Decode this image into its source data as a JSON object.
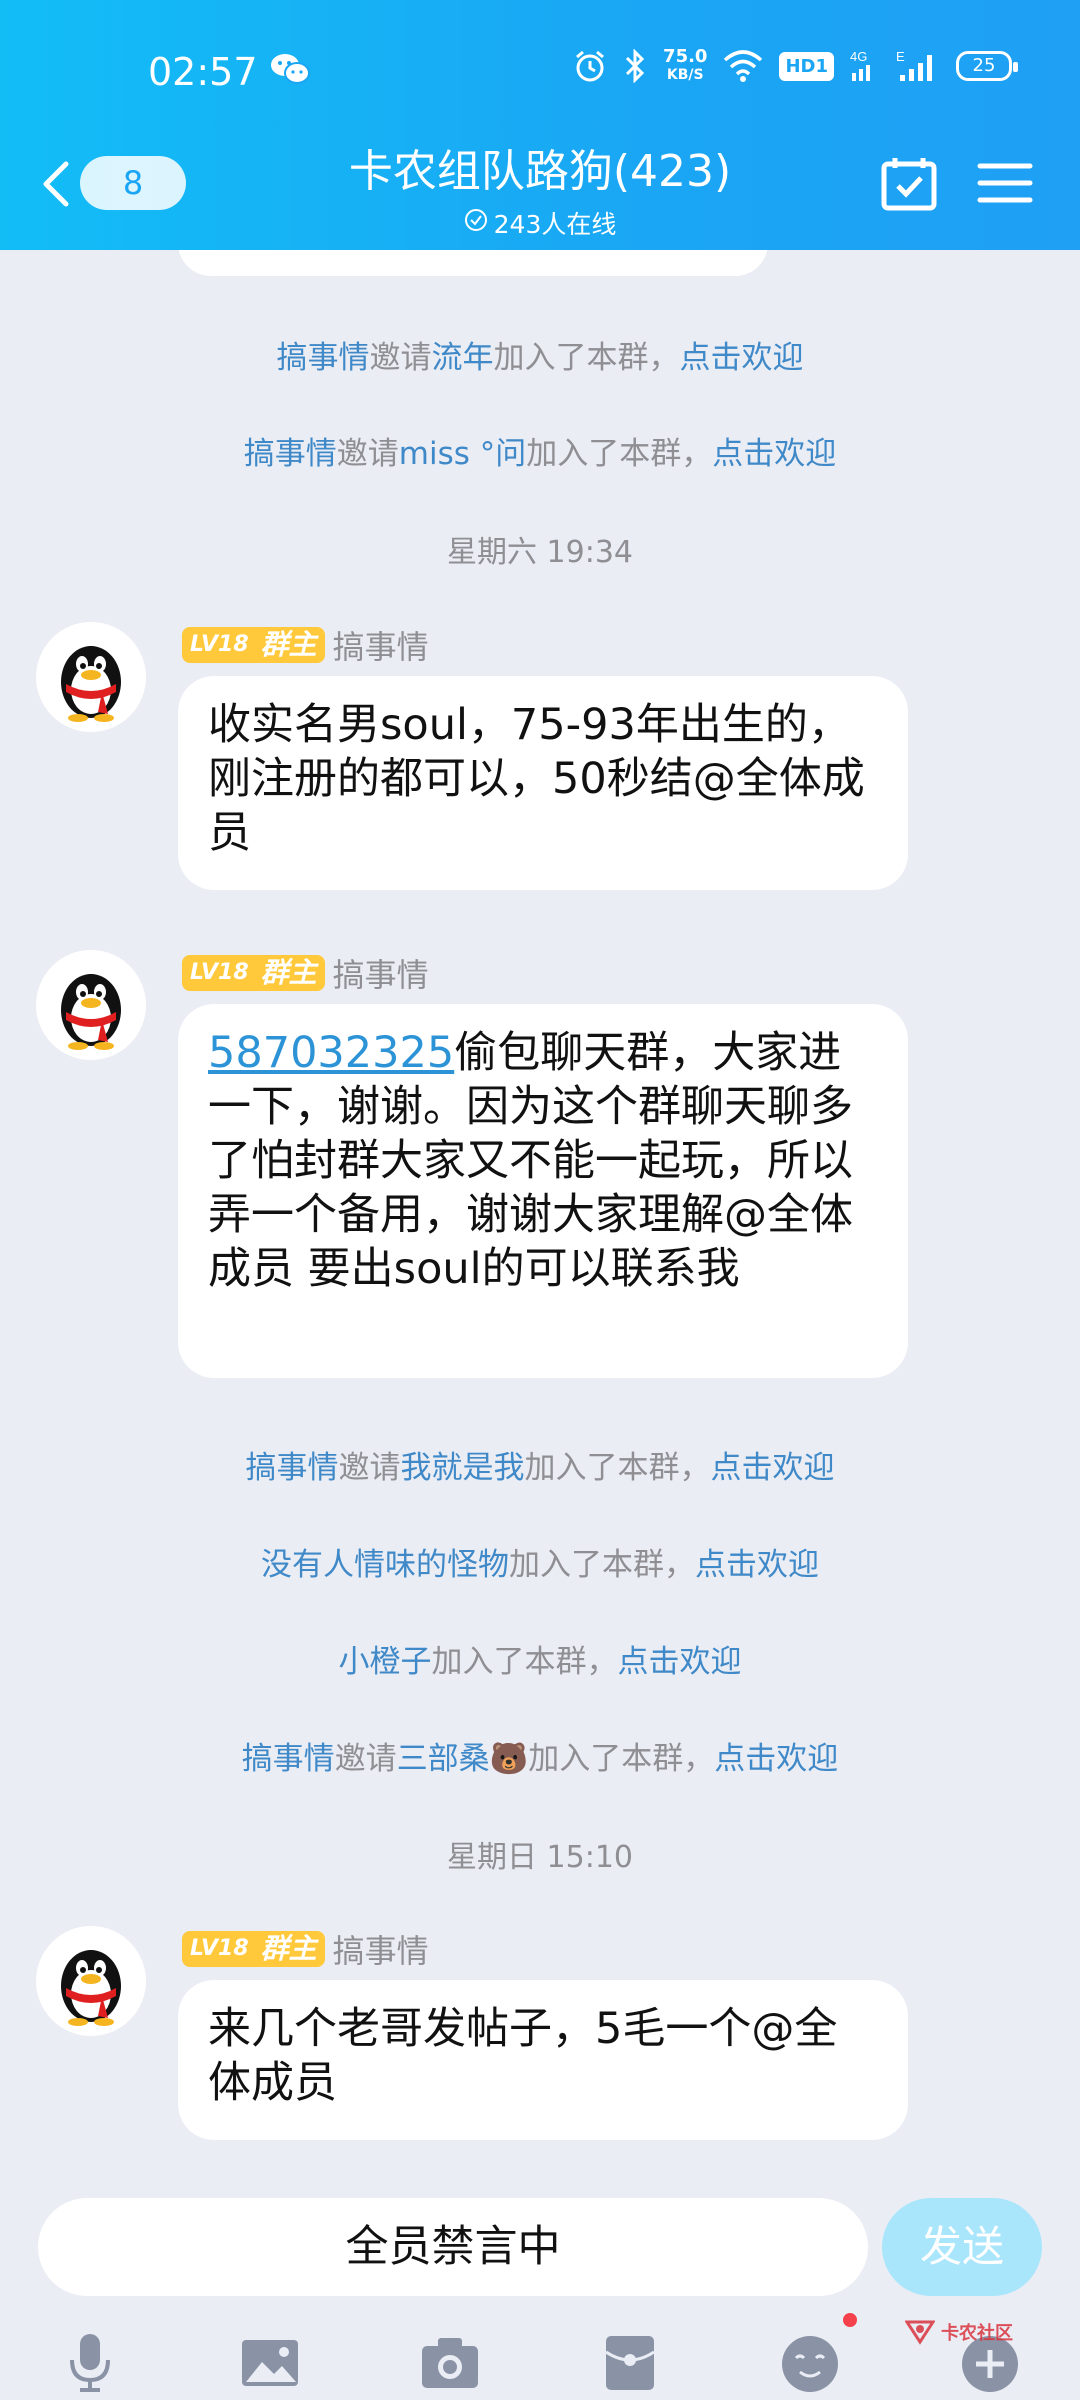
{
  "status_bar": {
    "time": "02:57",
    "net_speed_value": "75.0",
    "net_speed_unit": "KB/S",
    "hd_badge": "HD1",
    "network_4g": "4G",
    "network_e": "E",
    "battery": "25"
  },
  "header": {
    "back_count": "8",
    "title": "卡农组队路狗(423)",
    "online": "243人在线"
  },
  "system_messages": [
    {
      "inviter": "搞事情",
      "verb": "邀请",
      "member": "流年",
      "joined": "加入了本群，",
      "action": "点击欢迎"
    },
    {
      "inviter": "搞事情",
      "verb": "邀请",
      "member": "miss °问",
      "joined": "加入了本群，",
      "action": "点击欢迎"
    },
    {
      "inviter": "搞事情",
      "verb": "邀请",
      "member": "我就是我",
      "joined": "加入了本群，",
      "action": "点击欢迎"
    },
    {
      "inviter": "",
      "verb": "",
      "member": "没有人情味的怪物",
      "joined": "加入了本群，",
      "action": "点击欢迎"
    },
    {
      "inviter": "",
      "verb": "",
      "member": "小橙子",
      "joined": "加入了本群，",
      "action": "点击欢迎"
    },
    {
      "inviter": "搞事情",
      "verb": "邀请",
      "member": "三部桑🐻",
      "joined": "加入了本群，",
      "action": "点击欢迎"
    }
  ],
  "timestamps": [
    "星期六 19:34",
    "星期日 15:10"
  ],
  "badge": {
    "level": "LV18",
    "role": "群主"
  },
  "messages": [
    {
      "sender": "搞事情",
      "link": "",
      "text": "收实名男soul，75-93年出生的，刚注册的都可以，50秒结@全体成员"
    },
    {
      "sender": "搞事情",
      "link": "587032325",
      "text": "偷包聊天群，大家进一下，谢谢。因为这个群聊天聊多了怕封群大家又不能一起玩，所以弄一个备用，谢谢大家理解@全体成员  要出soul的可以联系我"
    },
    {
      "sender": "搞事情",
      "link": "",
      "text": "来几个老哥发帖子，5毛一个@全体成员"
    }
  ],
  "input": {
    "muted_text": "全员禁言中",
    "send_label": "发送"
  },
  "watermark": {
    "text": "卡农社区"
  },
  "colors": {
    "header_start": "#12bdf6",
    "header_end": "#1fa0f5",
    "chat_bg": "#ebedf5",
    "link": "#3f89c8",
    "badge": "#ffc93b",
    "send_disabled": "#a9e6fb"
  },
  "icons": [
    "wechat-icon",
    "alarm-icon",
    "bluetooth-icon",
    "wifi-icon",
    "signal-icon",
    "chevron-left-icon",
    "check-circle-icon",
    "calendar-check-icon",
    "menu-icon",
    "microphone-icon",
    "image-icon",
    "camera-icon",
    "red-packet-icon",
    "emoji-icon",
    "plus-icon",
    "qq-penguin-icon"
  ]
}
